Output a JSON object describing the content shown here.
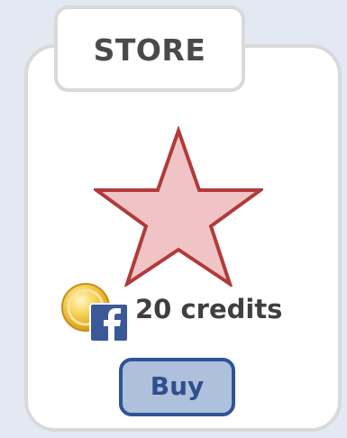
{
  "store": {
    "title": "STORE"
  },
  "item": {
    "icon": "star-icon",
    "price": "20 credits",
    "currency_icon": "facebook-credits-coin-icon",
    "buy_label": "Buy"
  },
  "colors": {
    "background": "#e3e9f3",
    "card_border": "#d9d9d9",
    "star_fill": "#f0c4c4",
    "star_stroke": "#b23a3a",
    "button_fill": "#aec0dc",
    "button_border": "#2f5496",
    "button_text": "#2f4f8d",
    "facebook_blue": "#3b5998",
    "coin_gold": "#f5c23a"
  }
}
